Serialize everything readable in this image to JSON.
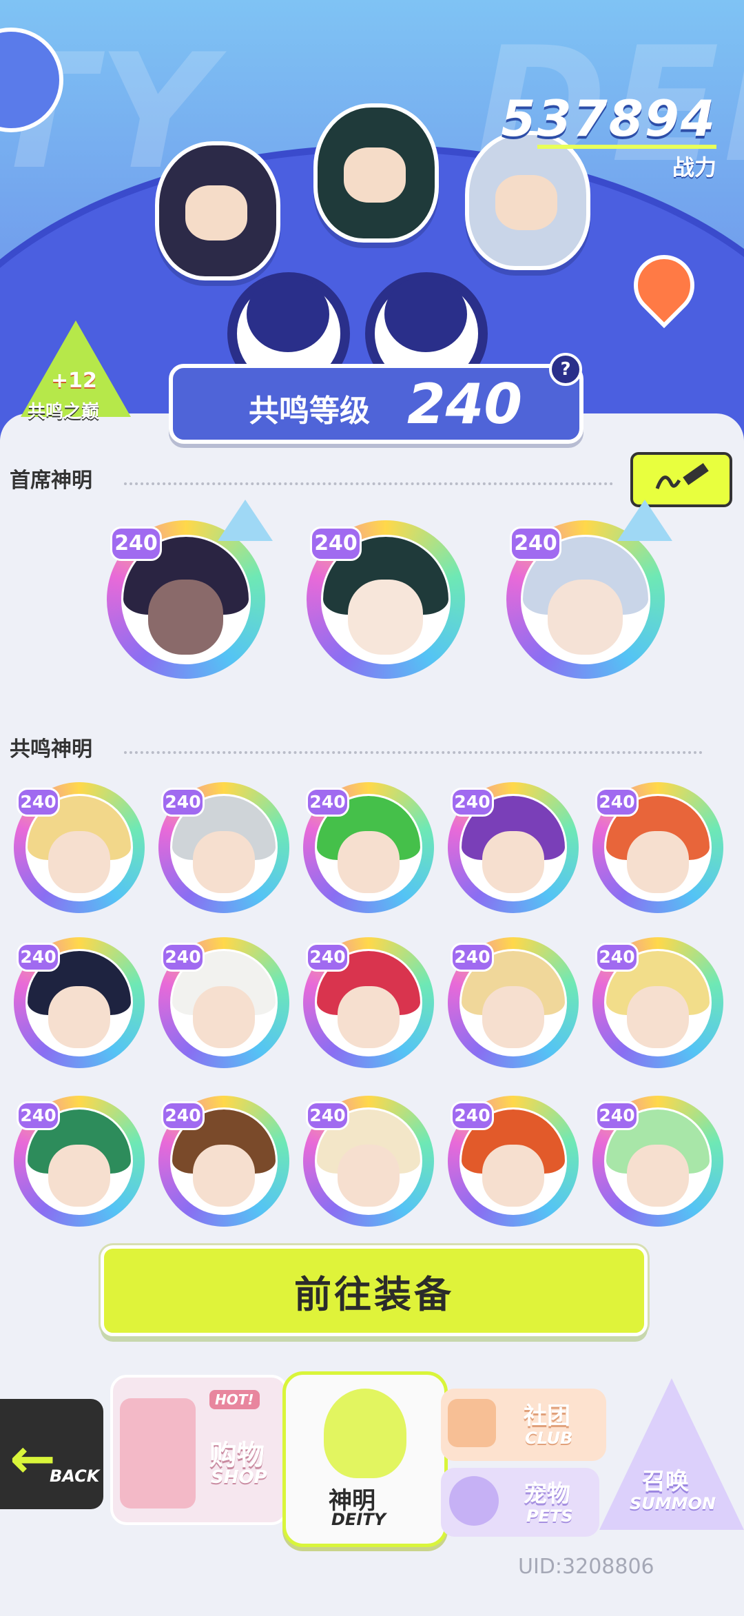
{
  "header": {
    "combat_power": "537894",
    "combat_power_label": "战力",
    "resonance_peak": {
      "bonus": "+12",
      "label": "共鸣之巅"
    },
    "resonance_level_title": "共鸣等级",
    "resonance_level": "240",
    "help": "?"
  },
  "sections": {
    "main_deities_title": "首席神明",
    "resonance_deities_title": "共鸣神明"
  },
  "main_deities": [
    {
      "level": "240",
      "hair": "#2a2442",
      "skin": "#8a6a6a"
    },
    {
      "level": "240",
      "hair": "#1f3a3a",
      "skin": "#f7e6da"
    },
    {
      "level": "240",
      "hair": "#c9d5e8",
      "skin": "#f5e2d6"
    }
  ],
  "resonance_deities": [
    {
      "level": "240",
      "hair": "#f2d78a"
    },
    {
      "level": "240",
      "hair": "#cfd4d8"
    },
    {
      "level": "240",
      "hair": "#45c04a"
    },
    {
      "level": "240",
      "hair": "#7a3fb8"
    },
    {
      "level": "240",
      "hair": "#e8653a"
    },
    {
      "level": "240",
      "hair": "#1e2340"
    },
    {
      "level": "240",
      "hair": "#f2f2ef"
    },
    {
      "level": "240",
      "hair": "#d9344e"
    },
    {
      "level": "240",
      "hair": "#f0d79a"
    },
    {
      "level": "240",
      "hair": "#f2dd8a"
    },
    {
      "level": "240",
      "hair": "#2d8c5b"
    },
    {
      "level": "240",
      "hair": "#7a4a2a"
    },
    {
      "level": "240",
      "hair": "#f3e6c8"
    },
    {
      "level": "240",
      "hair": "#e25a2a"
    },
    {
      "level": "240",
      "hair": "#a8e6a8"
    }
  ],
  "actions": {
    "go_equip": "前往装备"
  },
  "nav": {
    "back": "BACK",
    "shop_zh": "购物",
    "shop_en": "SHOP",
    "shop_tag": "HOT!",
    "deity_zh": "神明",
    "deity_en": "DEITY",
    "club_zh": "社团",
    "club_en": "CLUB",
    "pets_zh": "宠物",
    "pets_en": "PETS",
    "summon_zh": "召唤",
    "summon_en": "SUMMON"
  },
  "uid": "UID:3208806",
  "colors": {
    "accent": "#dff33a",
    "banner": "#6a86e8",
    "level_badge": "#a06af0"
  }
}
